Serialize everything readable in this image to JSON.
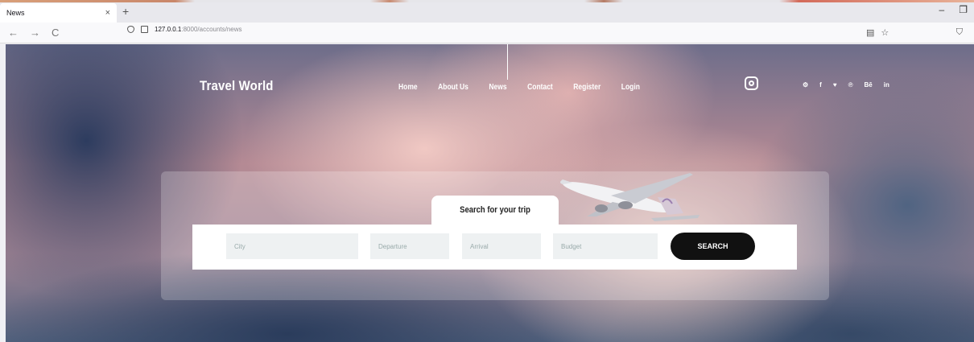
{
  "browser": {
    "tab_title": "News",
    "tab_close": "×",
    "new_tab": "+",
    "minimize": "–",
    "restore": "❐",
    "back": "←",
    "forward": "→",
    "reload": "C",
    "url_host": "127.0.0.1",
    "url_path": ":8000/accounts/news",
    "reader_icon": "▤",
    "bookmark_icon": "☆",
    "pocket_icon": "⛉"
  },
  "site": {
    "brand": "Travel World",
    "menu": [
      {
        "label": "Home"
      },
      {
        "label": "About Us"
      },
      {
        "label": "News"
      },
      {
        "label": "Contact"
      },
      {
        "label": "Register"
      },
      {
        "label": "Login"
      }
    ],
    "socials": [
      {
        "icon": "dribbble-icon",
        "glyph": "⚙"
      },
      {
        "icon": "facebook-icon",
        "glyph": "f"
      },
      {
        "icon": "twitter-icon",
        "glyph": "♥"
      },
      {
        "icon": "pinterest-icon",
        "glyph": "℗"
      },
      {
        "icon": "behance-icon",
        "glyph": "Bē"
      },
      {
        "icon": "linkedin-icon",
        "glyph": "in"
      }
    ]
  },
  "search": {
    "tab_label": "Search for your trip",
    "city_placeholder": "City",
    "departure_placeholder": "Departure",
    "arrival_placeholder": "Arrival",
    "budget_placeholder": "Budget",
    "button_label": "SEARCH"
  },
  "colors": {
    "search_button": "#111111",
    "field_bg": "#eef1f2"
  }
}
